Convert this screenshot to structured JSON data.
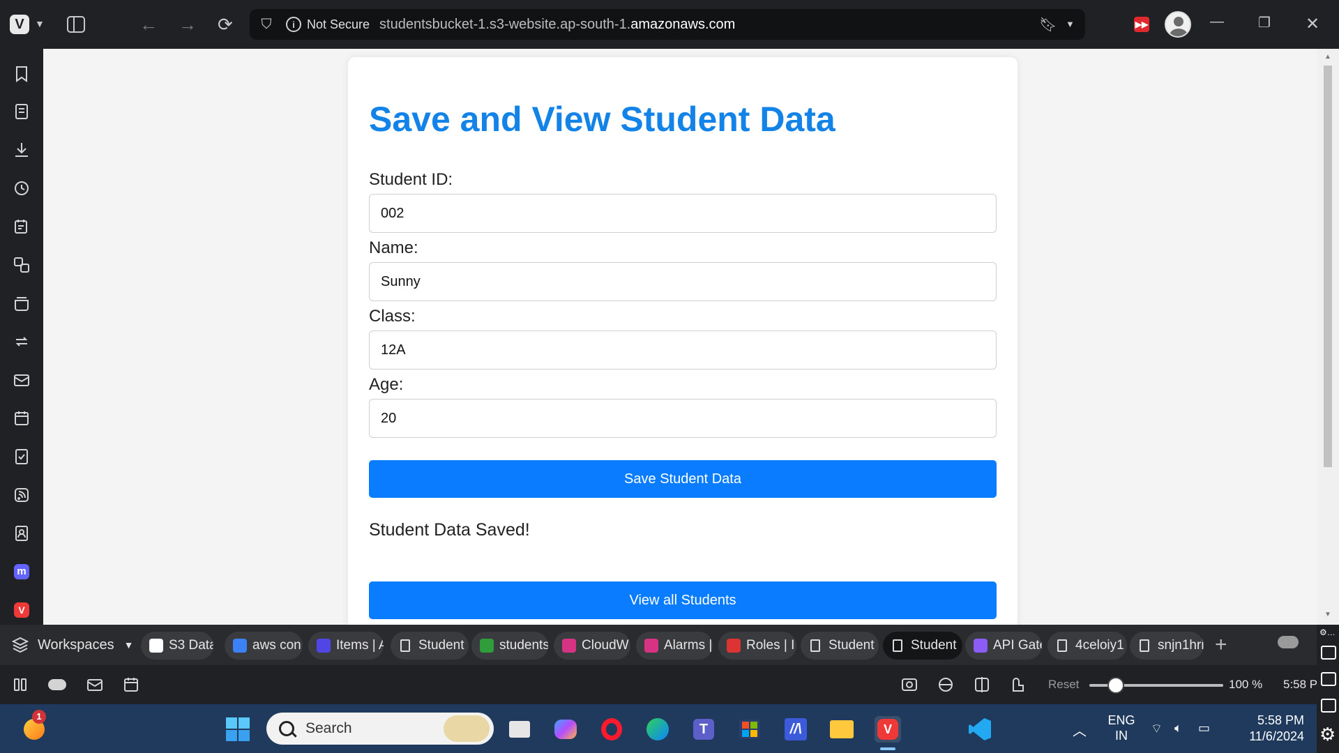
{
  "browser": {
    "url_security": "Not Secure",
    "url_prefix": "studentsbucket-1.s3-website.ap-south-1.",
    "url_domain": "amazonaws.com"
  },
  "page": {
    "title": "Save and View Student Data",
    "fields": [
      {
        "label": "Student ID:",
        "value": "002"
      },
      {
        "label": "Name:",
        "value": "Sunny"
      },
      {
        "label": "Class:",
        "value": "12A"
      },
      {
        "label": "Age:",
        "value": "20"
      }
    ],
    "save_button": "Save Student Data",
    "status_message": "Student Data Saved!",
    "view_button": "View all Students"
  },
  "tabbar": {
    "workspaces_label": "Workspaces",
    "tabs": [
      {
        "label": "S3 Data",
        "icon": "openai-icon",
        "color": "#ffffff"
      },
      {
        "label": "aws con",
        "icon": "search-icon",
        "color": "#3b82f6"
      },
      {
        "label": "Items | A",
        "icon": "dynamodb-icon",
        "color": "#4f46e5"
      },
      {
        "label": "Student",
        "icon": "document-icon",
        "color": "#dddddd"
      },
      {
        "label": "students",
        "icon": "s3-icon",
        "color": "#2e9d3a"
      },
      {
        "label": "CloudW",
        "icon": "cloudwatch-icon",
        "color": "#d63384"
      },
      {
        "label": "Alarms |",
        "icon": "cloudwatch-icon",
        "color": "#d63384"
      },
      {
        "label": "Roles | I",
        "icon": "iam-icon",
        "color": "#dd3333"
      },
      {
        "label": "Student",
        "icon": "document-icon",
        "color": "#dddddd"
      },
      {
        "label": "Student",
        "icon": "document-icon",
        "color": "#dddddd"
      },
      {
        "label": "API Gate",
        "icon": "api-gateway-icon",
        "color": "#8b5cf6"
      },
      {
        "label": "4celoiy1",
        "icon": "document-icon",
        "color": "#dddddd"
      },
      {
        "label": "snjn1hri",
        "icon": "document-icon",
        "color": "#dddddd"
      }
    ]
  },
  "statusbar": {
    "reset_label": "Reset",
    "zoom_value": "100 %",
    "zoom_fraction": 0.2,
    "clock": "5:58 P"
  },
  "taskbar": {
    "search_placeholder": "Search",
    "notification_count": "1",
    "language_line1": "ENG",
    "language_line2": "IN",
    "time": "5:58 PM",
    "date": "11/6/2024"
  }
}
